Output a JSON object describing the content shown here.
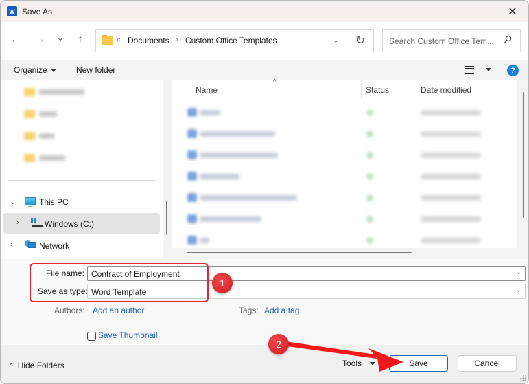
{
  "window": {
    "title": "Save As",
    "app_icon_letter": "W",
    "close_glyph": "✕"
  },
  "nav": {
    "back_glyph": "←",
    "forward_glyph": "→",
    "recent_glyph": "⌄",
    "up_glyph": "↑",
    "breadcrumb": {
      "overflow_glyph": "«",
      "items": [
        "Documents",
        "Custom Office Templates"
      ],
      "separator": "›",
      "dropdown_glyph": "⌄",
      "refresh_glyph": "↻"
    },
    "search_placeholder": "Search Custom Office Tem..."
  },
  "toolbar": {
    "organize_label": "Organize",
    "new_folder_label": "New folder",
    "help_glyph": "?"
  },
  "navigation_pane": {
    "blurred_folders_count": 4,
    "tree": [
      {
        "label": "This PC",
        "expanded": true,
        "icon": "computer-icon",
        "chevron": "⌄"
      },
      {
        "label": "Windows (C:)",
        "expanded": false,
        "selected": true,
        "icon": "drive-icon",
        "chevron": "›"
      },
      {
        "label": "Network",
        "expanded": false,
        "icon": "network-icon",
        "chevron": "›"
      }
    ]
  },
  "file_list": {
    "columns": [
      "Name",
      "Status",
      "Date modified"
    ],
    "sort_indicator": "^",
    "rows_blurred": 7
  },
  "form": {
    "file_name_label": "File name:",
    "file_name_value": "Contract of Employment",
    "save_as_type_label": "Save as type:",
    "save_as_type_value": "Word Template",
    "dropdown_glyph": "⌄",
    "authors_label": "Authors:",
    "authors_link": "Add an author",
    "tags_label": "Tags:",
    "tags_link": "Add a tag",
    "save_thumbnail_label": "Save Thumbnail",
    "save_thumbnail_checked": false
  },
  "footer": {
    "hide_folders_label": "Hide Folders",
    "hide_folders_glyph": "^",
    "tools_label": "Tools",
    "save_label": "Save",
    "cancel_label": "Cancel"
  },
  "annotations": {
    "badge_1": "1",
    "badge_2": "2",
    "color": "#e8262a"
  }
}
